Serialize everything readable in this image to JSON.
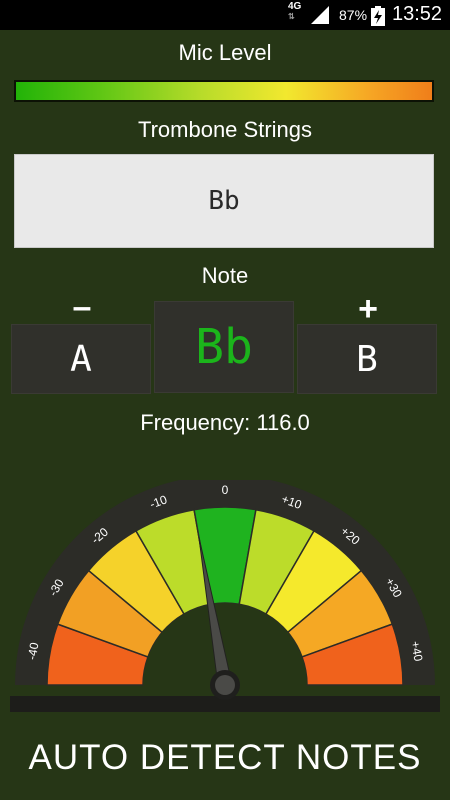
{
  "status_bar": {
    "network": "4G",
    "battery_percent": "87%",
    "time": "13:52"
  },
  "mic": {
    "label": "Mic Level",
    "level_fraction": 1.0
  },
  "strings": {
    "label": "Trombone Strings",
    "value": "Bb"
  },
  "note": {
    "label": "Note",
    "minus_label": "–",
    "plus_label": "+",
    "previous": "A",
    "current": "Bb",
    "next": "B"
  },
  "frequency": {
    "text": "Frequency: 116.0"
  },
  "gauge": {
    "ticks": [
      "-40",
      "-30",
      "-20",
      "-10",
      "0",
      "+10",
      "+20",
      "+30",
      "+40"
    ],
    "needle_value": -5,
    "segment_colors": [
      "#f0621c",
      "#f2a024",
      "#f5d22a",
      "#bcdc2a",
      "#1fb31f",
      "#bcdc2a",
      "#f5e92c",
      "#f5a824",
      "#f0621c"
    ]
  },
  "footer": {
    "button_label": "AUTO DETECT NOTES"
  }
}
